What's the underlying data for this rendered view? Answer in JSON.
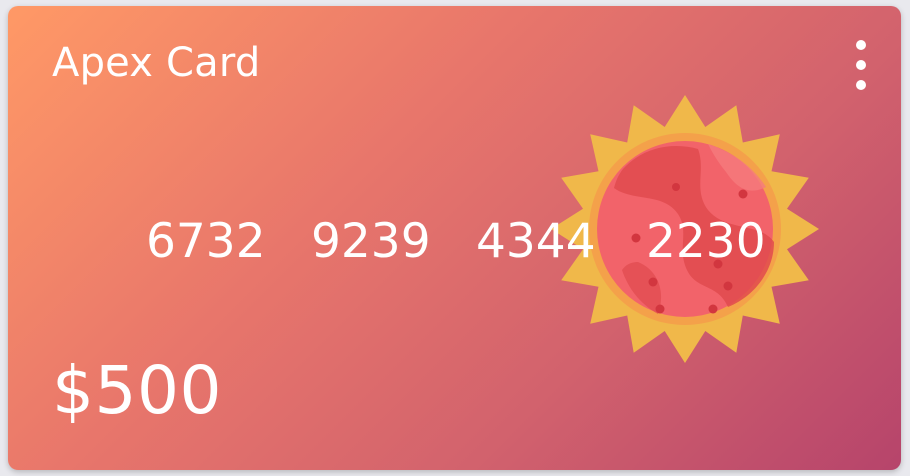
{
  "card": {
    "title": "Apex Card",
    "number_groups": [
      "6732",
      "9239",
      "4344",
      "2230"
    ],
    "balance": "$500",
    "menu_icon": "more-vert-icon",
    "emblem_icon": "sun-icon"
  },
  "colors": {
    "gradient_start": "#ff9966",
    "gradient_end": "#b6446b",
    "sun_rays": "#f0b84a",
    "sun_ring": "#f4a14a",
    "sun_core": "#f2636a"
  }
}
